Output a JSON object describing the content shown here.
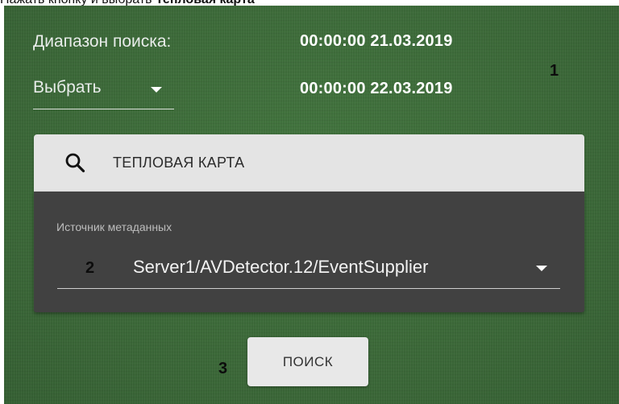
{
  "caption": {
    "prefix": "Нажать кнопку",
    "middle": " и выбрать ",
    "bold_tail": "Тепловая карта"
  },
  "filters": {
    "range_label": "Диапазон поиска:",
    "date_from": "00:00:00 21.03.2019",
    "date_to": "00:00:00 22.03.2019",
    "period_select_label": "Выбрать"
  },
  "search": {
    "label": "ТЕПЛОВАЯ КАРТА",
    "icon": "search-icon"
  },
  "metadata": {
    "label": "Источник метаданных",
    "value": "Server1/AVDetector.12/EventSupplier"
  },
  "actions": {
    "search_button_label": "ПОИСК"
  },
  "annotations": {
    "one": "1",
    "two": "2",
    "three": "3"
  },
  "colors": {
    "background_green": "#3d6b3a",
    "search_bar": "#e4e4e4",
    "metadata_card": "#414141",
    "button": "#e8e8e8"
  }
}
